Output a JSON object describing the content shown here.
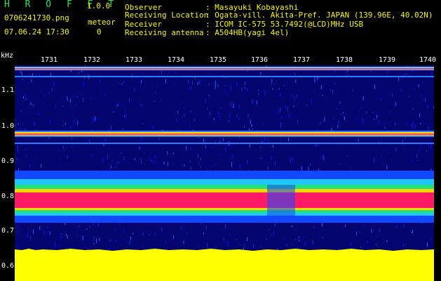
{
  "app": {
    "title": "H R O F F T",
    "version": "1.0.0"
  },
  "file_name": "0706241730.png",
  "date_time": "07.06.24 17:30",
  "meteor": {
    "label": "meteor",
    "count": "0"
  },
  "info": [
    {
      "label": "Observer",
      "value": ": Masayuki Kobayashi"
    },
    {
      "label": "Receiving Location",
      "value": ": Ogata-vill. Akita-Pref. JAPAN (139.96E, 40.02N)"
    },
    {
      "label": "Receiver",
      "value": ": ICOM IC-575 53.7492(@LCD)MHz USB"
    },
    {
      "label": "Receiving antenna",
      "value": ": A504HB(yagi 4el)"
    }
  ],
  "axis": {
    "y_unit": "kHz",
    "y_ticks": [
      "1.1",
      "1.0",
      "0.9",
      "0.8",
      "0.7",
      "0.6"
    ],
    "x_ticks": [
      "1731",
      "1732",
      "1733",
      "1734",
      "1735",
      "1736",
      "1737",
      "1738",
      "1739",
      "1740"
    ]
  },
  "colors": {
    "background": "#000000",
    "text_yellow": "#f5f500",
    "title_green": "#2ee05a",
    "noise_floor": "#050570",
    "signal_peak": "#ff1a66",
    "band_fill": "#ffff00"
  }
}
